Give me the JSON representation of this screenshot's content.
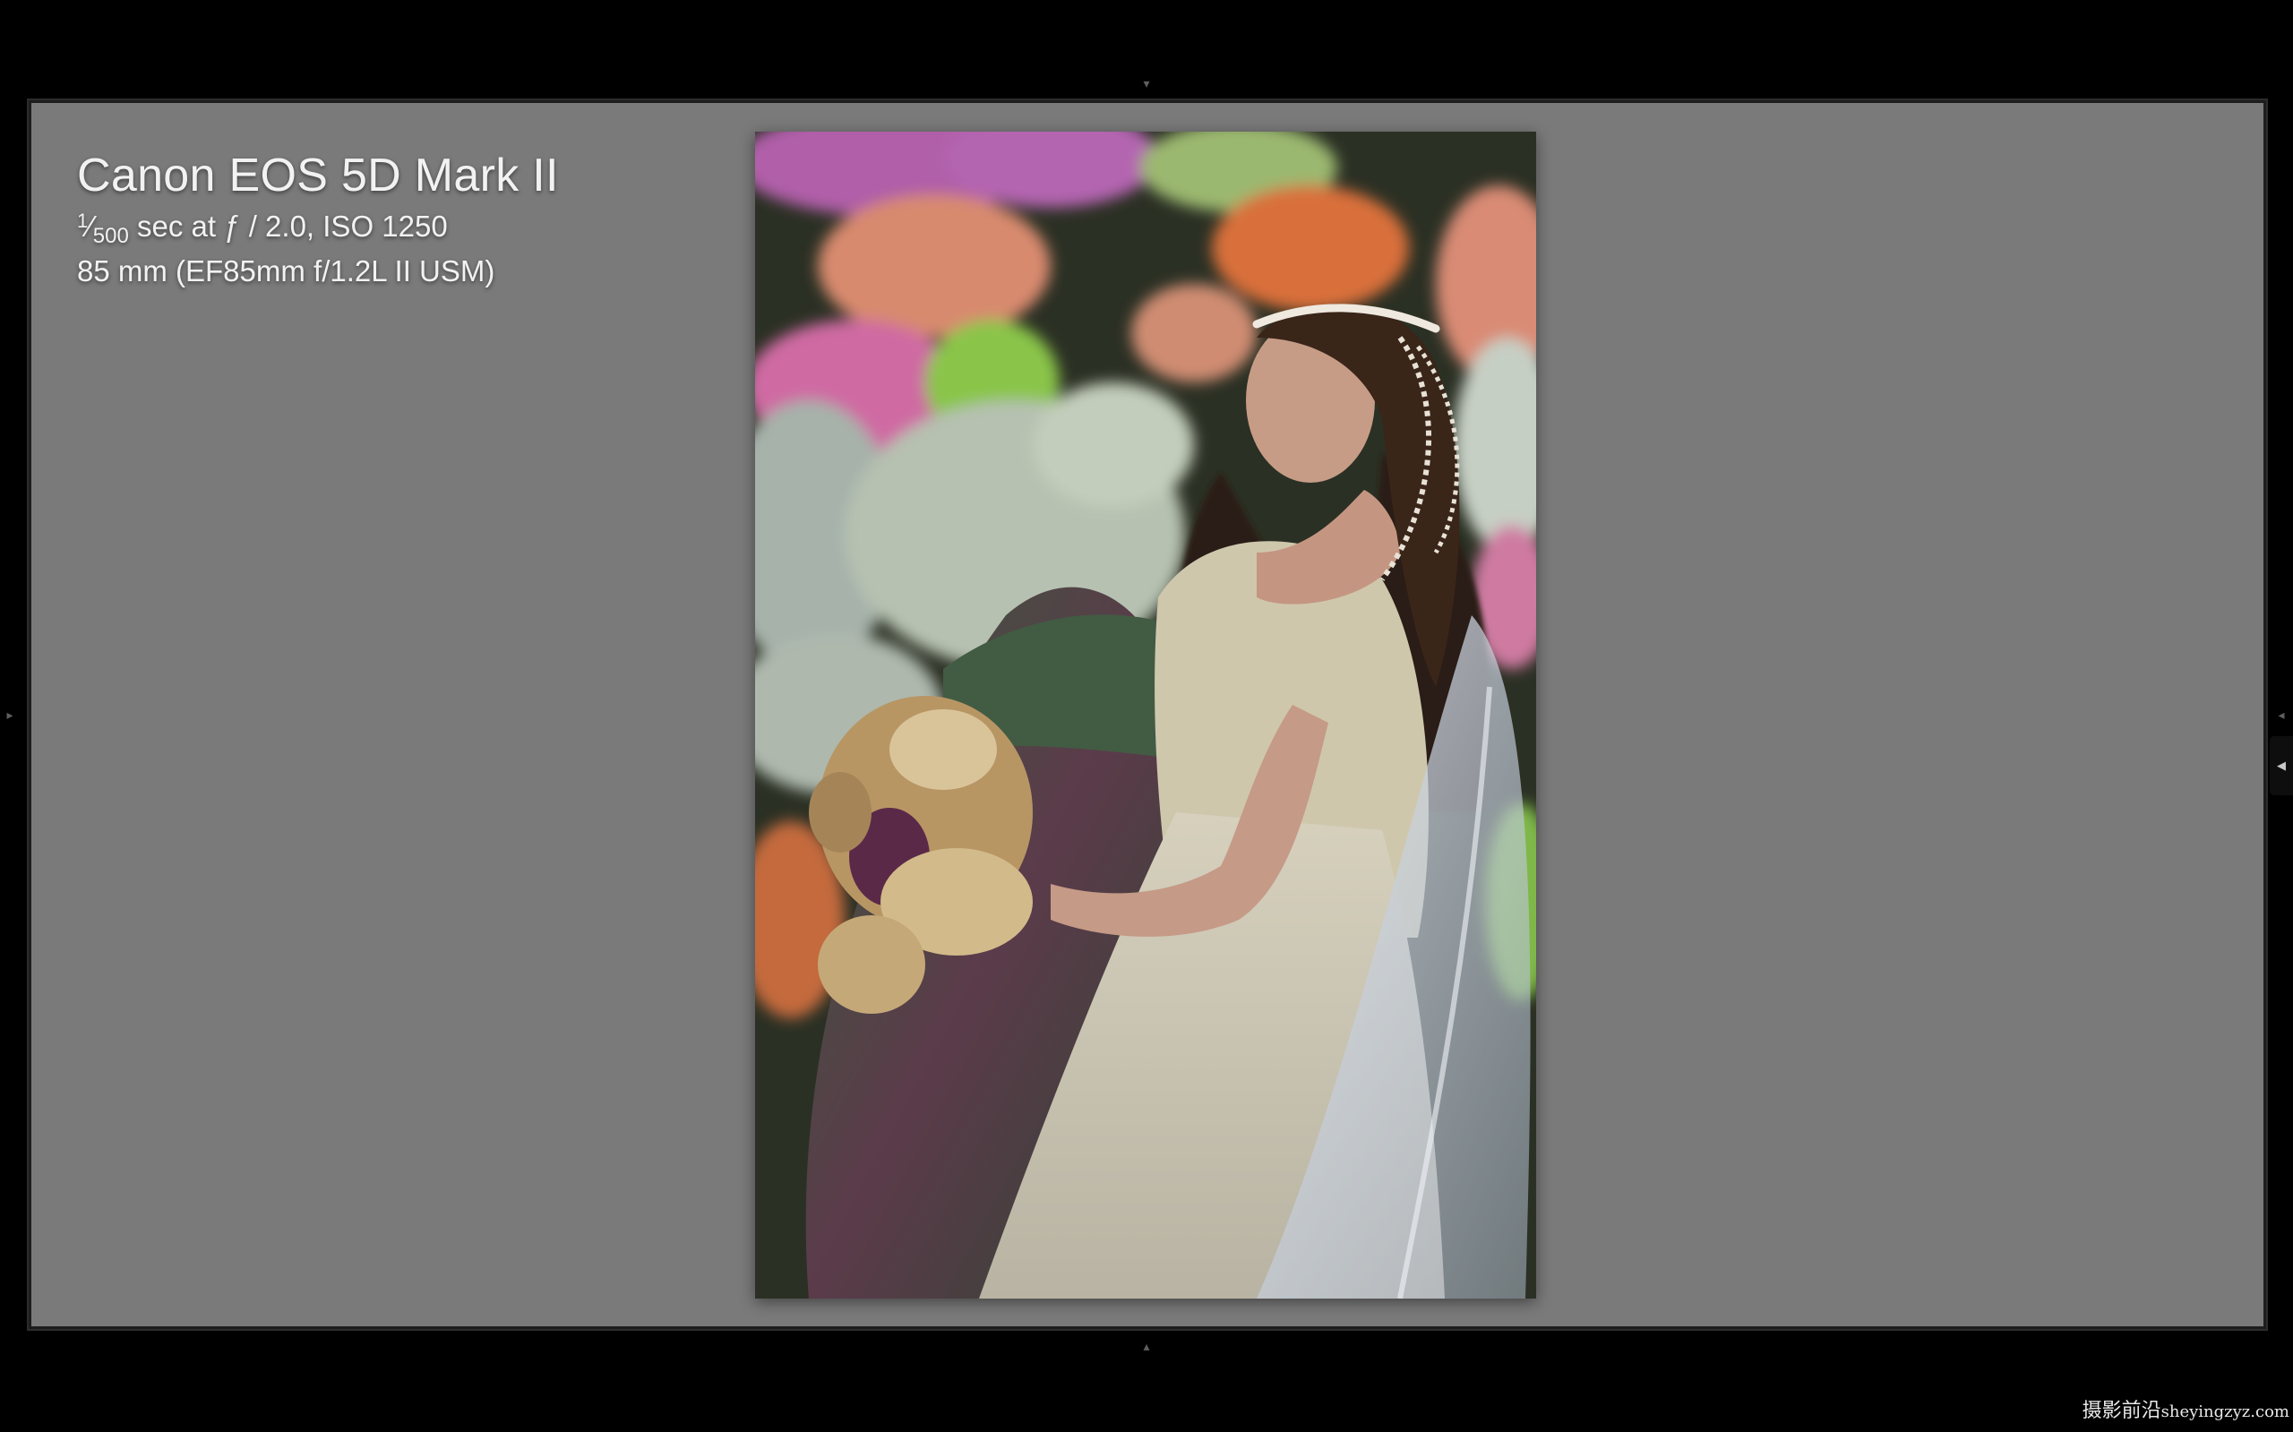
{
  "app": {
    "view_mode": "loupe",
    "background_color": "#7a7a7a",
    "chrome_color": "#000000"
  },
  "panels": {
    "top_toggle_icon": "triangle-down-icon",
    "bottom_toggle_icon": "triangle-up-icon",
    "left_toggle_icon": "triangle-right-icon",
    "right_toggle_icon": "triangle-left-icon",
    "filmstrip_tab_icon": "caret-left-icon"
  },
  "info_overlay": {
    "camera": "Canon EOS 5D Mark II",
    "shutter_numerator": "1",
    "shutter_denominator": "500",
    "exposure_rest": " sec at ƒ / 2.0, ISO 1250",
    "lens": "85 mm (EF85mm f/1.2L II USM)"
  },
  "photo": {
    "subject": "portrait of a woman with pearl headpiece holding a bouquet in front of a floral wall"
  },
  "watermark": {
    "chinese": "摄影前沿",
    "latin": "sheyingzyz.com"
  }
}
